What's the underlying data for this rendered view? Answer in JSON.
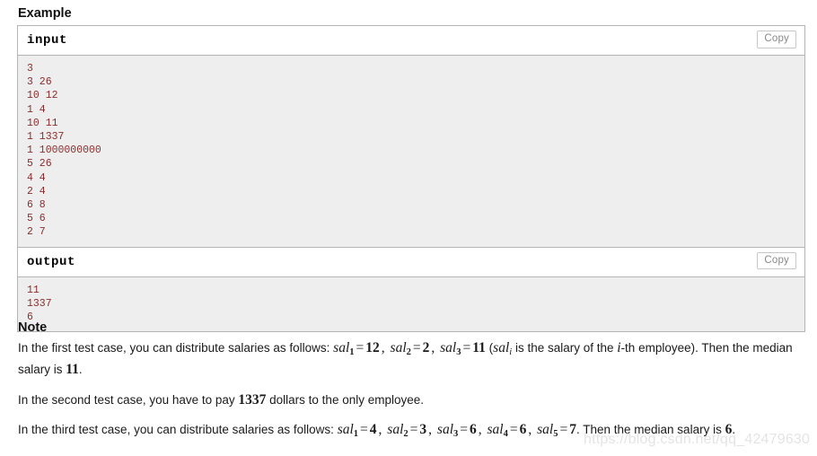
{
  "example": {
    "heading": "Example",
    "input": {
      "label": "input",
      "copy_label": "Copy",
      "content": "3\n3 26\n10 12\n1 4\n10 11\n1 1337\n1 1000000000\n5 26\n4 4\n2 4\n6 8\n5 6\n2 7"
    },
    "output": {
      "label": "output",
      "copy_label": "Copy",
      "content": "11\n1337\n6"
    }
  },
  "note": {
    "heading": "Note",
    "paragraphs": [
      {
        "id": "first-test-case",
        "segments": [
          {
            "type": "text",
            "value": "In the first test case, you can distribute salaries as follows: "
          },
          {
            "type": "math",
            "value": "sal_1 = 12, sal_2 = 2, sal_3 = 11"
          },
          {
            "type": "text",
            "value": " ("
          },
          {
            "type": "math",
            "value": "sal_i"
          },
          {
            "type": "text",
            "value": " is the salary of the "
          },
          {
            "type": "math",
            "value": "i"
          },
          {
            "type": "text",
            "value": "-th employee). Then the median salary is "
          },
          {
            "type": "math",
            "value": "11"
          },
          {
            "type": "text",
            "value": "."
          }
        ]
      },
      {
        "id": "second-test-case",
        "segments": [
          {
            "type": "text",
            "value": "In the second test case, you have to pay "
          },
          {
            "type": "math",
            "value": "1337"
          },
          {
            "type": "text",
            "value": " dollars to the only employee."
          }
        ]
      },
      {
        "id": "third-test-case",
        "segments": [
          {
            "type": "text",
            "value": "In the third test case, you can distribute salaries as follows: "
          },
          {
            "type": "math",
            "value": "sal_1 = 4, sal_2 = 3, sal_3 = 6, sal_4 = 6, sal_5 = 7"
          },
          {
            "type": "text",
            "value": ". Then the median salary is "
          },
          {
            "type": "math",
            "value": "6"
          },
          {
            "type": "text",
            "value": "."
          }
        ]
      }
    ],
    "note_1_text_a": "In the first test case, you can distribute salaries as follows: ",
    "note_1_text_b": " is the salary of the ",
    "note_1_text_c": "-th employee). Then the median salary is ",
    "note_2_text_a": "In the second test case, you have to pay ",
    "note_2_value": "1337",
    "note_2_text_b": " dollars to the only employee.",
    "note_3_text_a": "In the third test case, you can distribute salaries as follows: ",
    "note_3_text_b": ". Then the median salary is ",
    "note_3_value": "6"
  },
  "watermark": {
    "text": "https://blog.csdn.net/qq_42479630"
  },
  "colors": {
    "code_text": "#8b2d2d",
    "code_background": "#eeeeee",
    "border": "#b4b4b4",
    "copy_button_text": "#888888",
    "watermark": "#e4e4e4"
  }
}
